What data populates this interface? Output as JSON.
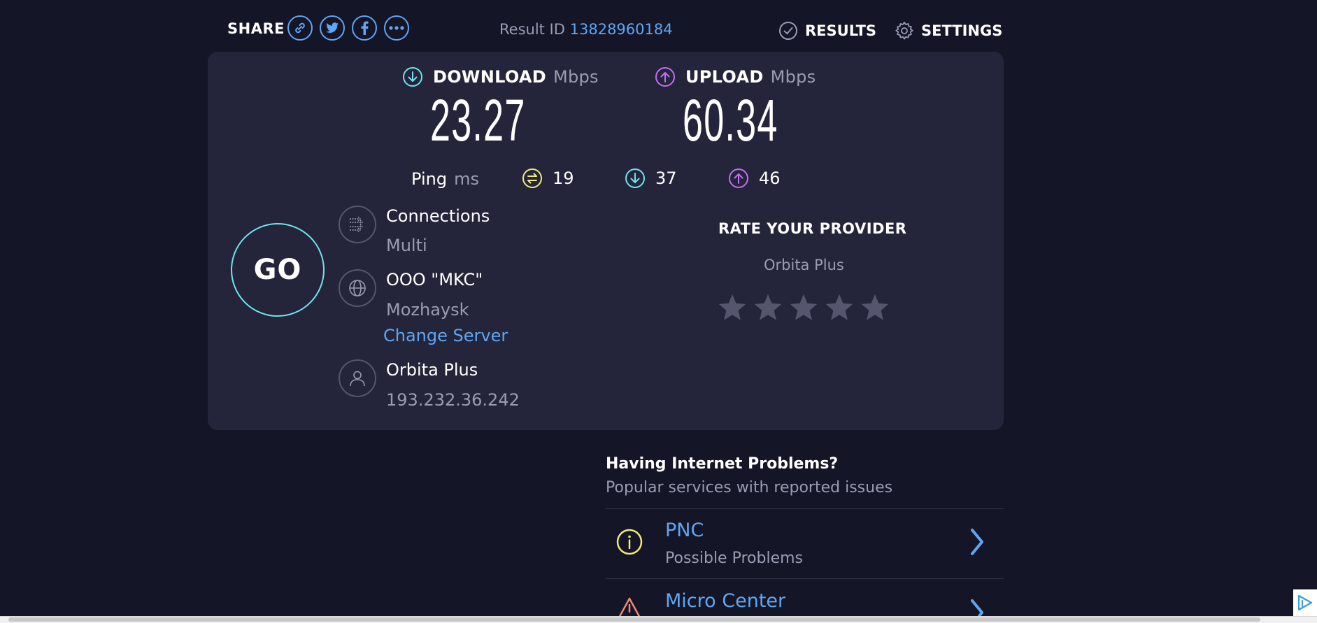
{
  "share": {
    "label": "SHARE",
    "icons": [
      "link-icon",
      "twitter-icon",
      "facebook-icon",
      "more-icon"
    ]
  },
  "result": {
    "label": "Result ID",
    "id": "13828960184"
  },
  "nav": {
    "results": "RESULTS",
    "settings": "SETTINGS"
  },
  "download": {
    "label": "DOWNLOAD",
    "unit": "Mbps",
    "value": "23.27"
  },
  "upload": {
    "label": "UPLOAD",
    "unit": "Mbps",
    "value": "60.34"
  },
  "ping": {
    "label": "Ping",
    "unit": "ms",
    "idle": "19",
    "download": "37",
    "upload": "46"
  },
  "go": {
    "label": "GO"
  },
  "connections": {
    "title": "Connections",
    "value": "Multi"
  },
  "server": {
    "name": "OOO \"MKC\"",
    "location": "Mozhaysk",
    "change_label": "Change Server"
  },
  "provider": {
    "name": "Orbita Plus",
    "ip": "193.232.36.242"
  },
  "rating": {
    "title": "RATE YOUR PROVIDER",
    "provider": "Orbita Plus",
    "stars_filled": 0,
    "stars_total": 5
  },
  "problems": {
    "title": "Having Internet Problems?",
    "subtitle": "Popular services with reported issues",
    "items": [
      {
        "name": "PNC",
        "status": "Possible Problems",
        "icon": "info-icon"
      },
      {
        "name": "Micro Center",
        "status": "",
        "icon": "warning-icon"
      }
    ]
  },
  "colors": {
    "background": "#141526",
    "panel": "#24253a",
    "accent_blue": "#5fa6f5",
    "download_cyan": "#6ee4f0",
    "upload_purple": "#c36df5",
    "ping_yellow": "#f3e97a",
    "muted_text": "#9b9cb4",
    "star_grey": "#55566e"
  }
}
